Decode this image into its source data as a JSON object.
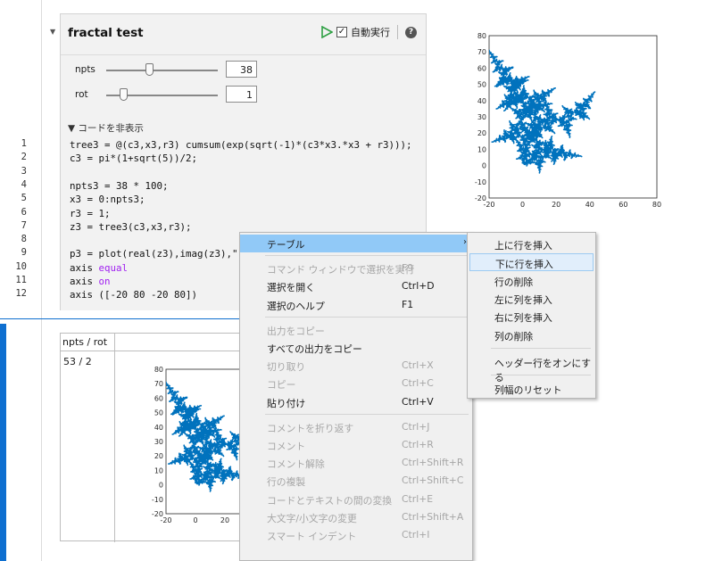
{
  "line_numbers": [
    "1",
    "2",
    "3",
    "4",
    "5",
    "6",
    "7",
    "8",
    "9",
    "10",
    "11",
    "12"
  ],
  "control": {
    "title": "fractal test",
    "auto_run_label": "自動実行",
    "auto_run_checked": "✓",
    "help_glyph": "?",
    "params": [
      {
        "name": "npts",
        "value": "38",
        "slider_fraction": 0.38
      },
      {
        "name": "rot",
        "value": "1",
        "slider_fraction": 0.15
      }
    ],
    "hide_code_label": "▼ コードを非表示"
  },
  "code_lines": [
    {
      "text": "tree3 = @(c3,x3,r3) cumsum(exp(sqrt(-1)*(c3*x3.*x3 + r3)));"
    },
    {
      "text": "c3 = pi*(1+sqrt(5))/2;"
    },
    {
      "text": ""
    },
    {
      "text": "npts3 = 38 * 100;"
    },
    {
      "text": "x3 = 0:npts3;"
    },
    {
      "text": "r3 = 1;"
    },
    {
      "text": "z3 = tree3(c3,x3,r3);"
    },
    {
      "text": ""
    },
    {
      "text": "p3 = plot(real(z3),imag(z3),\""
    },
    {
      "text": "axis ",
      "kw": "equal"
    },
    {
      "text": "axis ",
      "kw": "on"
    },
    {
      "text": "axis ([-20 80 -20 80])"
    }
  ],
  "output_table": {
    "header": "npts / rot",
    "row_label": "53 / 2"
  },
  "chart_data": [
    {
      "type": "scatter",
      "x_ticks": [
        "-20",
        "0",
        "20",
        "40",
        "60",
        "80"
      ],
      "y_ticks": [
        "80",
        "70",
        "60",
        "50",
        "40",
        "30",
        "20",
        "10",
        "0",
        "-10",
        "-20"
      ],
      "xlim": [
        -20,
        80
      ],
      "ylim": [
        -20,
        80
      ],
      "color": "#0072bd"
    },
    {
      "type": "scatter",
      "x_ticks": [
        "-20",
        "0",
        "20"
      ],
      "y_ticks": [
        "80",
        "70",
        "60",
        "50",
        "40",
        "30",
        "20",
        "10",
        "0",
        "-10",
        "-20"
      ],
      "xlim": [
        -20,
        80
      ],
      "ylim": [
        -20,
        80
      ],
      "color": "#0072bd"
    }
  ],
  "context_menu": {
    "items": [
      {
        "label": "テーブル",
        "shortcut": "",
        "state": "highlight",
        "submenu": true
      },
      {
        "sep": true
      },
      {
        "label": "コマンド ウィンドウで選択を実行",
        "shortcut": "F9",
        "state": "disabled"
      },
      {
        "label": "選択を開く",
        "shortcut": "Ctrl+D",
        "state": "enabled"
      },
      {
        "label": "選択のヘルプ",
        "shortcut": "F1",
        "state": "enabled"
      },
      {
        "sep": true
      },
      {
        "label": "出力をコピー",
        "shortcut": "",
        "state": "disabled"
      },
      {
        "label": "すべての出力をコピー",
        "shortcut": "",
        "state": "enabled"
      },
      {
        "label": "切り取り",
        "shortcut": "Ctrl+X",
        "state": "disabled"
      },
      {
        "label": "コピー",
        "shortcut": "Ctrl+C",
        "state": "disabled"
      },
      {
        "label": "貼り付け",
        "shortcut": "Ctrl+V",
        "state": "enabled"
      },
      {
        "sep": true
      },
      {
        "label": "コメントを折り返す",
        "shortcut": "Ctrl+J",
        "state": "disabled"
      },
      {
        "label": "コメント",
        "shortcut": "Ctrl+R",
        "state": "disabled"
      },
      {
        "label": "コメント解除",
        "shortcut": "Ctrl+Shift+R",
        "state": "disabled"
      },
      {
        "label": "行の複製",
        "shortcut": "Ctrl+Shift+C",
        "state": "disabled"
      },
      {
        "label": "コードとテキストの間の変換",
        "shortcut": "Ctrl+E",
        "state": "disabled"
      },
      {
        "label": "大文字/小文字の変更",
        "shortcut": "Ctrl+Shift+A",
        "state": "disabled"
      },
      {
        "label": "スマート インデント",
        "shortcut": "Ctrl+I",
        "state": "disabled"
      }
    ],
    "submenu_items": [
      {
        "label": "上に行を挿入",
        "state": "enabled"
      },
      {
        "label": "下に行を挿入",
        "state": "hover"
      },
      {
        "label": "行の削除",
        "state": "enabled"
      },
      {
        "label": "左に列を挿入",
        "state": "enabled"
      },
      {
        "label": "右に列を挿入",
        "state": "enabled"
      },
      {
        "label": "列の削除",
        "state": "enabled"
      },
      {
        "sep": true
      },
      {
        "label": "ヘッダー行をオンにする",
        "state": "enabled"
      },
      {
        "sep": true
      },
      {
        "label": "列幅のリセット",
        "state": "enabled"
      }
    ]
  }
}
